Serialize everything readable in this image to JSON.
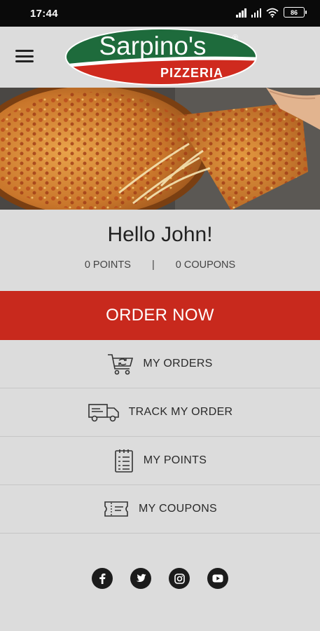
{
  "status_bar": {
    "time": "17:44",
    "battery": "86"
  },
  "header": {
    "menu_icon": "hamburger-icon",
    "logo": {
      "name": "Sarpino's",
      "mark": "®",
      "subtitle": "PIZZERIA"
    }
  },
  "hero": {
    "image": "pizza-photo"
  },
  "profile": {
    "greeting": "Hello John!",
    "points": "0 POINTS",
    "separator": "|",
    "coupons": "0 COUPONS"
  },
  "order_now": {
    "label": "ORDER NOW"
  },
  "menu": [
    {
      "label": "MY ORDERS",
      "icon": "cart-refresh-icon"
    },
    {
      "label": "TRACK MY ORDER",
      "icon": "delivery-truck-icon"
    },
    {
      "label": "MY POINTS",
      "icon": "checklist-icon"
    },
    {
      "label": "MY COUPONS",
      "icon": "coupon-ticket-icon"
    }
  ],
  "social": [
    {
      "icon": "facebook-icon"
    },
    {
      "icon": "twitter-icon"
    },
    {
      "icon": "instagram-icon"
    },
    {
      "icon": "youtube-icon"
    }
  ],
  "colors": {
    "brand_red": "#c8291d",
    "brand_green": "#1e6b3c",
    "background": "#dcdcdc"
  }
}
